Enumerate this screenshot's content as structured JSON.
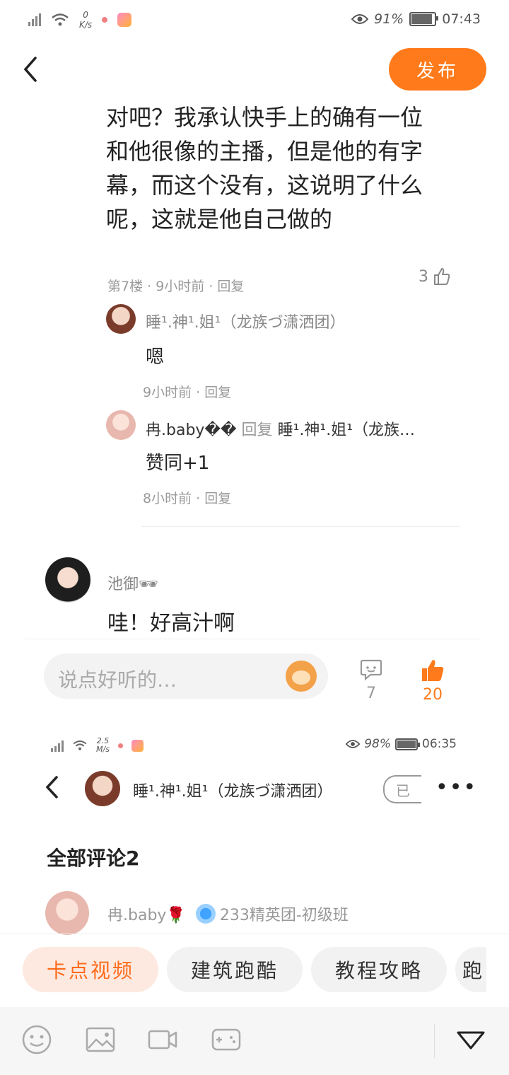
{
  "status_bar": {
    "speed_value": "0",
    "speed_unit": "K/s",
    "battery": "91%",
    "time": "07:43"
  },
  "header": {
    "back_icon": "back-arrow-icon",
    "publish_label": "发布"
  },
  "post": {
    "text": "对吧？我承认快手上的确有一位和他很像的主播，但是他的有字幕，而这个没有，这说明了什么呢，这就是他自己做的",
    "meta": "第7楼 · 9小时前 · 回复",
    "likes": "3"
  },
  "replies": [
    {
      "name": "睡¹.神¹.姐¹（龙族づ潇洒团）",
      "text": "嗯",
      "meta": "9小时前 · 回复"
    },
    {
      "name": "冉.baby��",
      "reply_word": "回复",
      "target": "睡¹.神¹.姐¹（龙族…",
      "text": "赞同+1",
      "meta": "8小时前 · 回复"
    }
  ],
  "comment": {
    "name": "池御🕶",
    "text": "哇！好高汁啊"
  },
  "comment_bar": {
    "placeholder": "说点好听的…",
    "comments_count": "7",
    "likes_count": "20"
  },
  "overlay": {
    "status": {
      "speed_value": "2.5",
      "speed_unit": "M/s",
      "battery": "98%",
      "time": "06:35"
    },
    "username": "睡¹.神¹.姐¹（龙族づ潇洒团）",
    "follow_label": "已",
    "section_title": "全部评论2",
    "commenter": "冉.baby🌹",
    "group": "233精英团-初级班"
  },
  "tags": [
    "卡点视频",
    "建筑跑酷",
    "教程攻略",
    "跑"
  ],
  "toolbar": {
    "icons": [
      "emoji-icon",
      "image-icon",
      "video-icon",
      "game-icon"
    ],
    "collapse_icon": "collapse-icon"
  },
  "colors": {
    "accent": "#ff7a1a"
  }
}
